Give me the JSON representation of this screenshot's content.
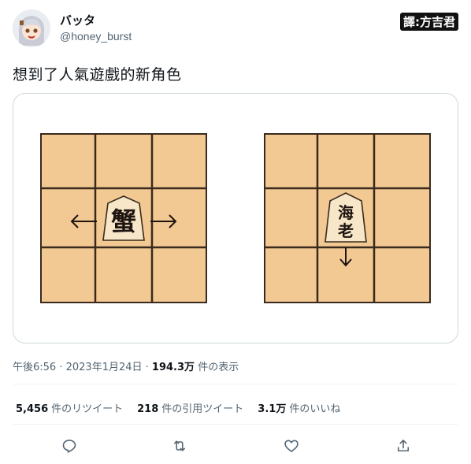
{
  "user": {
    "display_name": "バッタ",
    "handle": "@honey_burst"
  },
  "translator_credit": "譯:方吉君",
  "tweet": {
    "text": "想到了人氣遊戲的新角色"
  },
  "media": {
    "left_board": {
      "piece_text": "蟹",
      "arrows": [
        "left",
        "right"
      ]
    },
    "right_board": {
      "piece_line1": "海",
      "piece_line2": "老",
      "arrows": [
        "down"
      ]
    }
  },
  "meta": {
    "time": "午後6:56",
    "date": "2023年1月24日",
    "views_count": "194.3万",
    "views_label": "件の表示"
  },
  "stats": {
    "retweets_count": "5,456",
    "retweets_label": "件のリツイート",
    "quotes_count": "218",
    "quotes_label": "件の引用ツイート",
    "likes_count": "3.1万",
    "likes_label": "件のいいね"
  },
  "actions": [
    "reply-icon",
    "retweet-icon",
    "like-icon",
    "share-icon"
  ],
  "colors": {
    "board": "#f2c893",
    "board_line": "#3a2a1e",
    "piece": "#f7e7c8",
    "text_secondary": "#536471"
  }
}
